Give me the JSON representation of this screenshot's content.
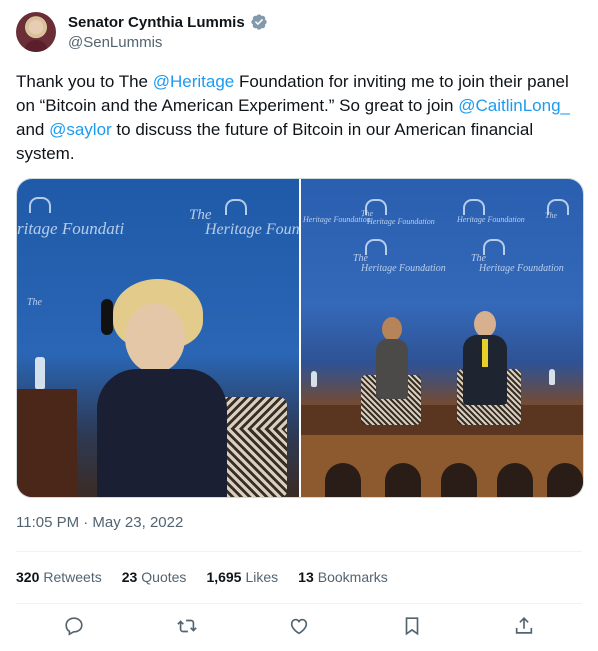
{
  "author": {
    "name": "Senator Cynthia Lummis",
    "handle": "@SenLummis",
    "verified": true,
    "verified_color": "#829aab"
  },
  "tweet": {
    "t1": "Thank you to The ",
    "m1": "@Heritage",
    "t2": " Foundation for inviting me to join their panel on “Bitcoin and the American Experiment.” So great to join ",
    "m2": "@CaitlinLong_",
    "t3": " and ",
    "m3": "@saylor",
    "t4": " to discuss the future of Bitcoin in our American financial system."
  },
  "media": {
    "logo_the": "The",
    "logo_heritage_foundation": "Heritage Foundation",
    "logo_fragment_left": "ritage Foundati",
    "logo_fragment_right": "Heritage Foun"
  },
  "timestamp": "11:05 PM · May 23, 2022",
  "stats": {
    "retweets_count": "320",
    "retweets_label": "Retweets",
    "quotes_count": "23",
    "quotes_label": "Quotes",
    "likes_count": "1,695",
    "likes_label": "Likes",
    "bookmarks_count": "13",
    "bookmarks_label": "Bookmarks"
  },
  "actions": [
    "reply-icon",
    "retweet-icon",
    "like-icon",
    "bookmark-icon",
    "share-icon"
  ],
  "colors": {
    "link": "#1d9bf0",
    "secondary_text": "#536471",
    "icon": "#536471"
  }
}
